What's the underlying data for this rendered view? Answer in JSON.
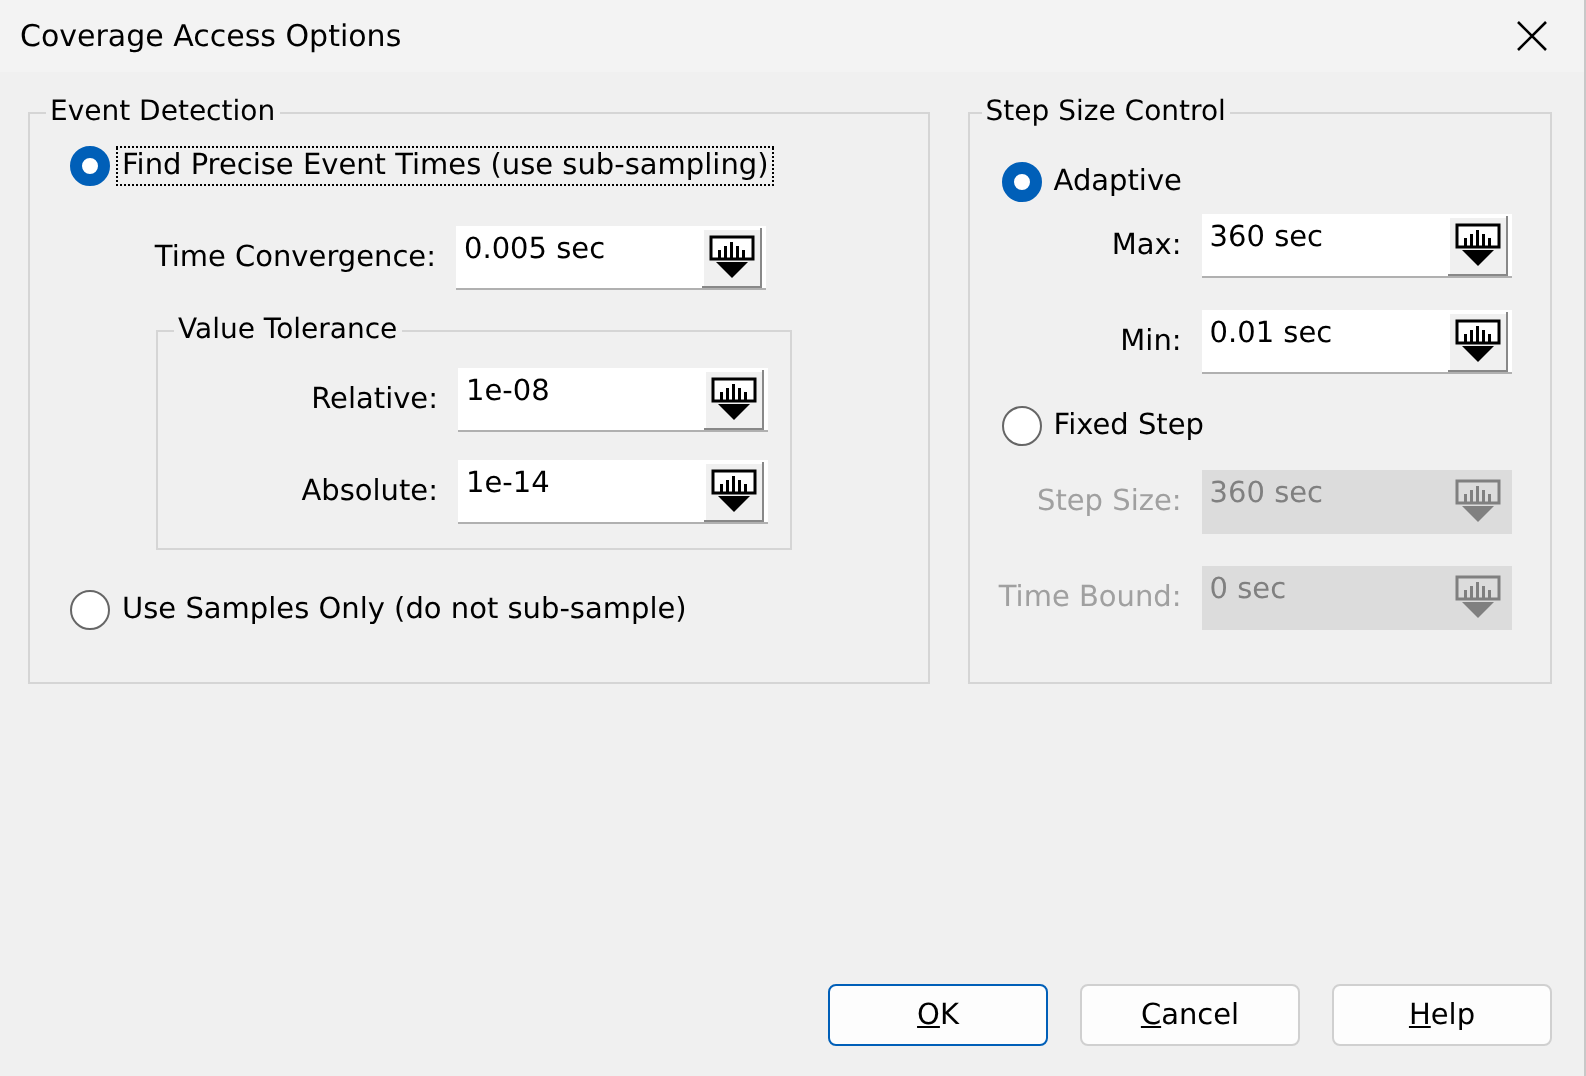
{
  "window": {
    "title": "Coverage Access Options"
  },
  "event_detection": {
    "title": "Event Detection",
    "precise_option": {
      "label": "Find Precise Event Times (use sub-sampling)",
      "selected": true,
      "focused": true
    },
    "time_convergence": {
      "label": "Time Convergence:",
      "value": "0.005 sec",
      "disabled": false
    },
    "value_tolerance": {
      "title": "Value Tolerance",
      "fields": [
        {
          "label": "Relative:",
          "value": "1e-08",
          "disabled": false
        },
        {
          "label": "Absolute:",
          "value": "1e-14",
          "disabled": false
        }
      ]
    },
    "samples_option": {
      "label": "Use Samples Only (do not sub-sample)",
      "selected": false,
      "focused": false
    }
  },
  "step_size_control": {
    "title": "Step Size Control",
    "adaptive_option": {
      "label": "Adaptive",
      "selected": true,
      "focused": false
    },
    "adaptive_fields": [
      {
        "label": "Max:",
        "value": "360 sec",
        "disabled": false
      },
      {
        "label": "Min:",
        "value": "0.01 sec",
        "disabled": false
      }
    ],
    "fixed_option": {
      "label": "Fixed Step",
      "selected": false,
      "focused": false
    },
    "fixed_fields": [
      {
        "label": "Step Size:",
        "value": "360 sec",
        "disabled": true
      },
      {
        "label": "Time Bound:",
        "value": "0 sec",
        "disabled": true
      }
    ]
  },
  "buttons": [
    {
      "label": "OK",
      "underline_first": true,
      "default": true
    },
    {
      "label": "Cancel",
      "underline_first": true,
      "default": false
    },
    {
      "label": "Help",
      "underline_first": true,
      "default": false
    }
  ]
}
